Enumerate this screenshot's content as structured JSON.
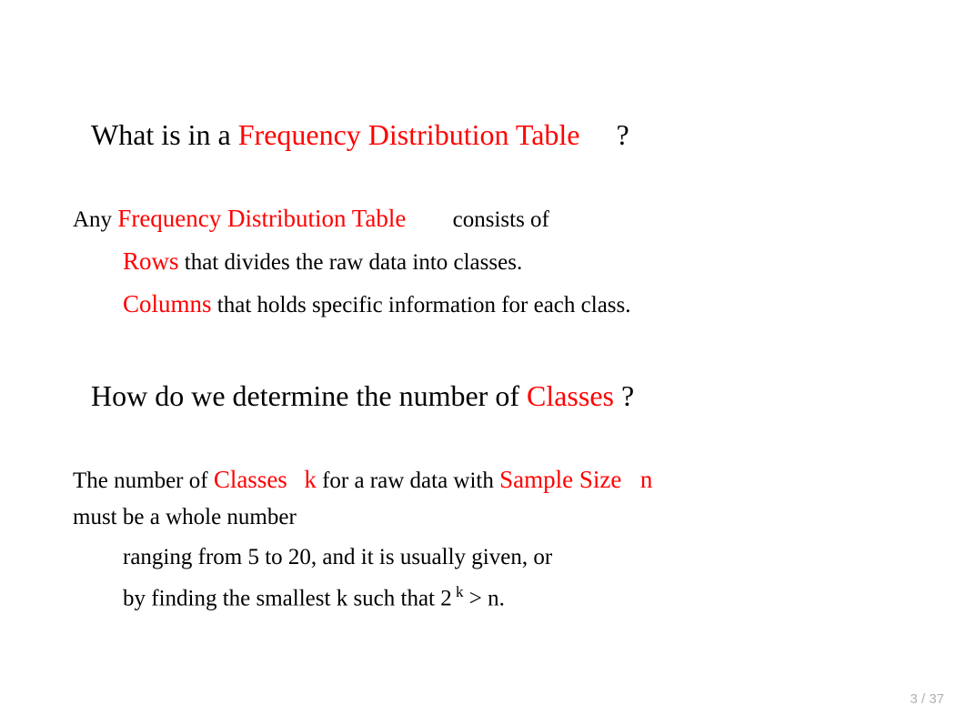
{
  "section1": {
    "heading_pre": "What is in a ",
    "heading_red": "Frequency Distribution Table",
    "heading_qmark": "?",
    "line1_pre": "Any ",
    "line1_red": "Frequency Distribution Table",
    "line1_post": " consists of",
    "line2_red": "Rows",
    "line2_post": " that divides the raw data into classes.",
    "line3_red": "Columns",
    "line3_post": " that holds specific information for each class."
  },
  "section2": {
    "heading_pre": "How do we determine the number of ",
    "heading_red": "Classes",
    "heading_qmark": " ?",
    "line1_pre": "The number of ",
    "line1_red1": "Classes",
    "line1_var1": "k",
    "line1_mid": " for a raw data with ",
    "line1_red2": "Sample Size",
    "line1_var2": "n",
    "line2": "must be a whole number",
    "line3": "ranging from 5 to 20, and it is usually given, or",
    "line4_pre": "by finding the smallest k such that 2",
    "line4_sup": " k",
    "line4_post": " >  n."
  },
  "page": {
    "current": "3",
    "separator": " / ",
    "total": "37"
  }
}
